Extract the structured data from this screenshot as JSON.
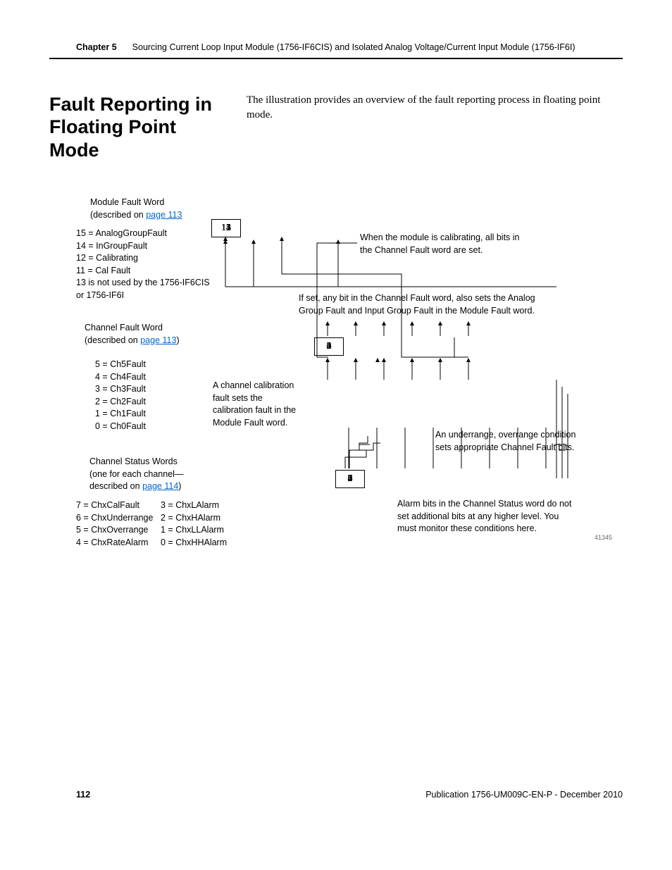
{
  "header": {
    "chapter": "Chapter 5",
    "title": "Sourcing Current Loop Input Module (1756-IF6CIS) and Isolated Analog Voltage/Current Input Module (1756-IF6I)"
  },
  "section": {
    "heading": "Fault Reporting in Floating Point Mode",
    "body": "The illustration provides an overview of the fault reporting process in floating point mode."
  },
  "diagram": {
    "module_fault_word": {
      "title": "Module Fault Word",
      "described_pre": "(described on ",
      "described_link": "page 113",
      "bits": [
        "15",
        "14",
        "13",
        "12",
        "11"
      ],
      "defs": [
        "15 = AnalogGroupFault",
        "14 = InGroupFault",
        "12 = Calibrating",
        "11 = Cal Fault",
        "13 is not used by the 1756-IF6CIS or 1756-IF6I"
      ]
    },
    "channel_fault_word": {
      "title": "Channel Fault Word",
      "described_pre": "(described on ",
      "described_link": "page 113",
      "described_post": ")",
      "bits": [
        "5",
        "4",
        "3",
        "2",
        "1",
        "0"
      ],
      "defs": [
        "5 = Ch5Fault",
        "4 = Ch4Fault",
        "3 = Ch3Fault",
        "2 = Ch2Fault",
        "1 = Ch1Fault",
        "0 = Ch0Fault"
      ]
    },
    "channel_status_words": {
      "title": "Channel Status Words",
      "sub1": "(one for each channel—",
      "sub2_pre": "described on ",
      "sub2_link": "page 114",
      "sub2_post": ")",
      "bits": [
        "7",
        "6",
        "5",
        "4",
        "3",
        "2",
        "1",
        "0"
      ],
      "defs_left": [
        "7 = ChxCalFault",
        "6 = ChxUnderrange",
        "5 = ChxOverrange",
        "4 = ChxRateAlarm"
      ],
      "defs_right": [
        "3 = ChxLAlarm",
        "2 = ChxHAlarm",
        "1 = ChxLLAlarm",
        "0 = ChxHHAlarm"
      ]
    },
    "notes": {
      "calibrating": "When the module is calibrating, all bits in the Channel Fault word are set.",
      "ifset": "If set, any bit in the Channel Fault word, also sets the Analog Group Fault and Input Group Fault in the Module Fault word.",
      "calfault": "A channel calibration fault sets the calibration fault in the Module Fault word.",
      "underrange": "An underrange, overrange condition sets appropriate Channel Fault bits.",
      "alarm": "Alarm bits in the Channel Status word do not set additional bits at any higher level. You must monitor these conditions here."
    },
    "fignum": "41345"
  },
  "footer": {
    "page": "112",
    "pub": "Publication 1756-UM009C-EN-P - December 2010"
  }
}
